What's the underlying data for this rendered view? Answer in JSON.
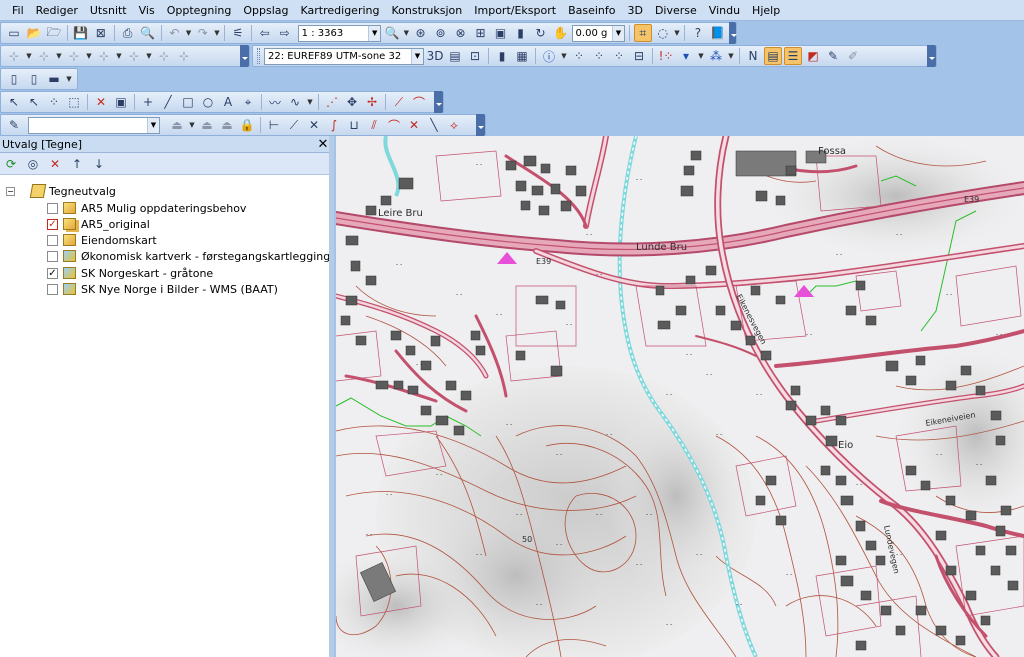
{
  "menu": [
    "Fil",
    "Rediger",
    "Utsnitt",
    "Vis",
    "Opptegning",
    "Oppslag",
    "Kartredigering",
    "Konstruksjon",
    "Import/Eksport",
    "Baseinfo",
    "3D",
    "Diverse",
    "Vindu",
    "Hjelp"
  ],
  "toolbar1": {
    "scale": "1 : 3363",
    "weight": "0.00 g"
  },
  "toolbar2": {
    "projection": "22: EUREF89 UTM-sone 32"
  },
  "toolbar5": {
    "layer_combo": ""
  },
  "panel": {
    "title": "Utvalg [Tegne]",
    "close": "✕",
    "root": "Tegneutvalg",
    "layers": [
      {
        "label": "AR5 Mulig oppdateringsbehov",
        "checked": false
      },
      {
        "label": "AR5_original",
        "checked": true
      },
      {
        "label": "Eiendomskart",
        "checked": false
      },
      {
        "label": "Økonomisk kartverk - førstegangskartlegging",
        "checked": false
      },
      {
        "label": "SK Norgeskart - gråtone",
        "checked": true
      },
      {
        "label": "SK Nye Norge i Bilder - WMS (BAAT)",
        "checked": false
      }
    ]
  },
  "map": {
    "labels": [
      "Leire Bru",
      "Lunde Bru",
      "E39",
      "E39",
      "Fossa",
      "Eikeneiveien",
      "Eio",
      "Eikenesvegen",
      "50",
      "Lundevegen"
    ]
  },
  "colors": {
    "menubar": "#cfe0f5",
    "workspace": "#a4c3e8",
    "road": "#c3516e",
    "contour": "#b0533e",
    "river": "#7fd8dc",
    "ar5_line": "#2bbf2b",
    "marker": "#e64fd7"
  }
}
